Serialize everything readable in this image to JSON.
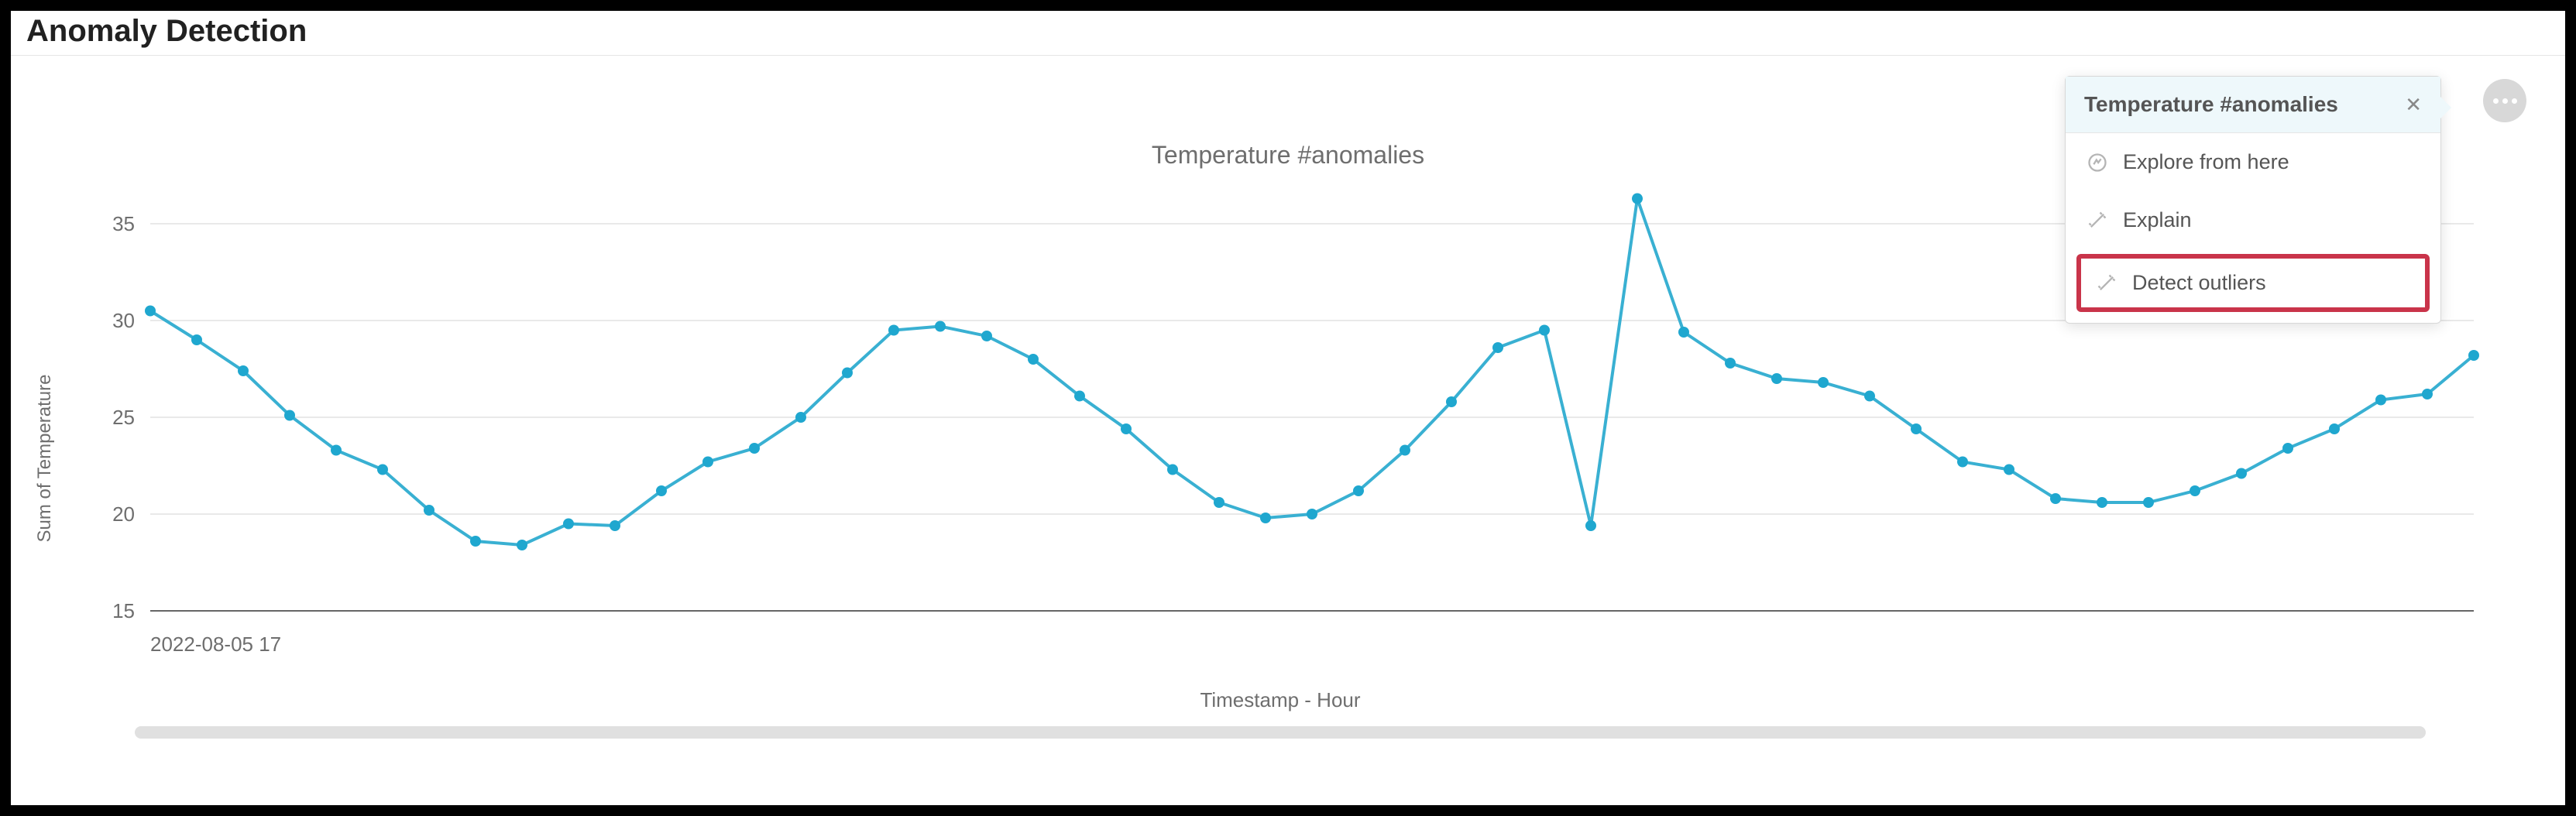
{
  "page": {
    "title": "Anomaly Detection"
  },
  "popover": {
    "title": "Temperature #anomalies",
    "items": {
      "explore": "Explore from here",
      "explain": "Explain",
      "detect": "Detect outliers"
    }
  },
  "chart_data": {
    "type": "line",
    "title": "Temperature #anomalies",
    "xlabel": "Timestamp - Hour",
    "ylabel": "Sum of Temperature",
    "ylim": [
      15,
      37
    ],
    "y_ticks": [
      15,
      20,
      25,
      30,
      35
    ],
    "x_tick_label_first": "2022-08-05 17",
    "series": [
      {
        "name": "Temperature",
        "color": "#1fa7cf",
        "values": [
          30.5,
          29.0,
          27.4,
          25.1,
          23.3,
          22.3,
          20.2,
          18.6,
          18.4,
          19.5,
          19.4,
          21.2,
          22.7,
          23.4,
          25.0,
          27.3,
          29.5,
          29.7,
          29.2,
          28.0,
          26.1,
          24.4,
          22.3,
          20.6,
          19.8,
          20.0,
          21.2,
          23.3,
          25.8,
          28.6,
          29.5,
          19.4,
          36.3,
          29.4,
          27.8,
          27.0,
          26.8,
          26.1,
          24.4,
          22.7,
          22.3,
          20.8,
          20.6,
          20.6,
          21.2,
          22.1,
          23.4,
          24.4,
          25.9,
          26.2,
          28.2
        ]
      }
    ]
  }
}
